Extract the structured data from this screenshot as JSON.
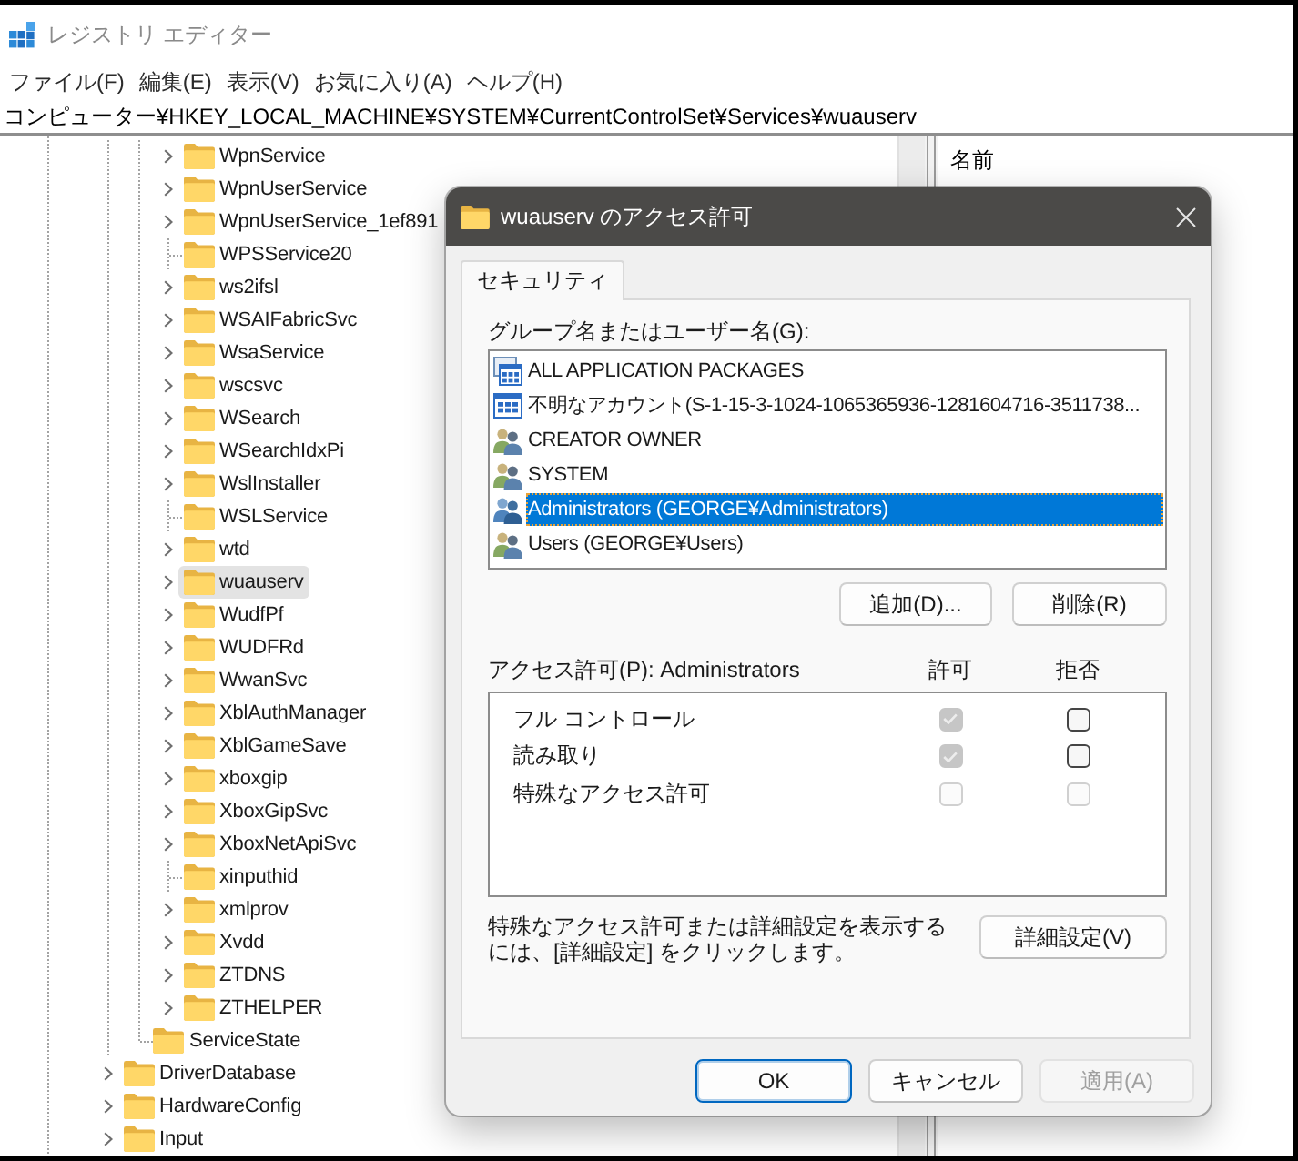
{
  "window": {
    "title": "レジストリ エディター"
  },
  "menu": [
    "ファイル(F)",
    "編集(E)",
    "表示(V)",
    "お気に入り(A)",
    "ヘルプ(H)"
  ],
  "address": "コンピューター¥HKEY_LOCAL_MACHINE¥SYSTEM¥CurrentControlSet¥Services¥wuauserv",
  "tree": {
    "items": [
      {
        "children": [
          {
            "children": [
              {
                "label": "WpnService",
                "expandable": true,
                "selected": false
              },
              {
                "label": "WpnUserService",
                "expandable": true,
                "selected": false
              },
              {
                "label": "WpnUserService_1ef891",
                "expandable": true,
                "selected": false
              },
              {
                "label": "WPSService20",
                "expandable": false,
                "selected": false
              },
              {
                "label": "ws2ifsl",
                "expandable": true,
                "selected": false
              },
              {
                "label": "WSAIFabricSvc",
                "expandable": true,
                "selected": false
              },
              {
                "label": "WsaService",
                "expandable": true,
                "selected": false
              },
              {
                "label": "wscsvc",
                "expandable": true,
                "selected": false
              },
              {
                "label": "WSearch",
                "expandable": true,
                "selected": false
              },
              {
                "label": "WSearchIdxPi",
                "expandable": true,
                "selected": false
              },
              {
                "label": "WslInstaller",
                "expandable": true,
                "selected": false
              },
              {
                "label": "WSLService",
                "expandable": false,
                "selected": false
              },
              {
                "label": "wtd",
                "expandable": true,
                "selected": false
              },
              {
                "label": "wuauserv",
                "expandable": true,
                "selected": true
              },
              {
                "label": "WudfPf",
                "expandable": true,
                "selected": false
              },
              {
                "label": "WUDFRd",
                "expandable": true,
                "selected": false
              },
              {
                "label": "WwanSvc",
                "expandable": true,
                "selected": false
              },
              {
                "label": "XblAuthManager",
                "expandable": true,
                "selected": false
              },
              {
                "label": "XblGameSave",
                "expandable": true,
                "selected": false
              },
              {
                "label": "xboxgip",
                "expandable": true,
                "selected": false
              },
              {
                "label": "XboxGipSvc",
                "expandable": true,
                "selected": false
              },
              {
                "label": "XboxNetApiSvc",
                "expandable": true,
                "selected": false
              },
              {
                "label": "xinputhid",
                "expandable": false,
                "selected": false
              },
              {
                "label": "xmlprov",
                "expandable": true,
                "selected": false
              },
              {
                "label": "Xvdd",
                "expandable": true,
                "selected": false
              },
              {
                "label": "ZTDNS",
                "expandable": true,
                "selected": false
              },
              {
                "label": "ZTHELPER",
                "expandable": true,
                "selected": false
              }
            ]
          },
          {
            "label": "ServiceState",
            "expandable": false,
            "selected": false
          }
        ]
      },
      {
        "label": "DriverDatabase",
        "expandable": true,
        "selected": false
      },
      {
        "label": "HardwareConfig",
        "expandable": true,
        "selected": false
      },
      {
        "label": "Input",
        "expandable": true,
        "selected": false
      }
    ]
  },
  "list_pane": {
    "columns": [
      "名前"
    ]
  },
  "dialog": {
    "title": "wuauserv のアクセス許可",
    "tabs": [
      {
        "label": "セキュリティ",
        "selected": true
      }
    ],
    "principals_label": "グループ名またはユーザー名(G):",
    "principals": [
      {
        "name": "ALL APPLICATION PACKAGES",
        "kind": "package",
        "selected": false
      },
      {
        "name": "不明なアカウント(S-1-15-3-1024-1065365936-1281604716-3511738...",
        "kind": "unknown",
        "selected": false
      },
      {
        "name": "CREATOR OWNER",
        "kind": "group",
        "selected": false
      },
      {
        "name": "SYSTEM",
        "kind": "group",
        "selected": false
      },
      {
        "name": "Administrators (GEORGE¥Administrators)",
        "kind": "group",
        "selected": true
      },
      {
        "name": "Users (GEORGE¥Users)",
        "kind": "group",
        "selected": false
      }
    ],
    "principal_buttons": [
      "追加(D)...",
      "削除(R)"
    ],
    "permissions_label": "アクセス許可(P): Administrators",
    "permission_columns": [
      "許可",
      "拒否"
    ],
    "permissions": [
      {
        "name": "フル コントロール",
        "allow": {
          "checked": true,
          "disabled": true
        },
        "deny": {
          "checked": false,
          "disabled": false
        }
      },
      {
        "name": "読み取り",
        "allow": {
          "checked": true,
          "disabled": true
        },
        "deny": {
          "checked": false,
          "disabled": false
        }
      },
      {
        "name": "特殊なアクセス許可",
        "allow": {
          "checked": false,
          "disabled": true
        },
        "deny": {
          "checked": false,
          "disabled": true
        }
      }
    ],
    "note": "特殊なアクセス許可または詳細設定を表示するには、[詳細設定] をクリックします。",
    "advanced_button": "詳細設定(V)",
    "buttons": [
      {
        "label": "OK",
        "default": true,
        "disabled": false
      },
      {
        "label": "キャンセル",
        "default": false,
        "disabled": false
      },
      {
        "label": "適用(A)",
        "default": false,
        "disabled": true
      }
    ]
  }
}
